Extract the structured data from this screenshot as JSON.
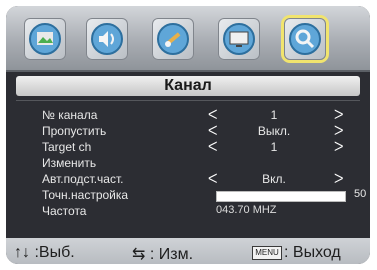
{
  "icons": [
    {
      "name": "picture-icon"
    },
    {
      "name": "sound-icon"
    },
    {
      "name": "tools-icon"
    },
    {
      "name": "tv-screen-icon"
    },
    {
      "name": "channel-search-icon"
    }
  ],
  "menu": {
    "title": "Канал",
    "rows": [
      {
        "label": "№ канала",
        "value": "1",
        "left_arrow": "ᐸ",
        "right_arrow": "ᐳ"
      },
      {
        "label": "Пропустить",
        "value": "Выкл.",
        "left_arrow": "ᐸ",
        "right_arrow": "ᐳ"
      },
      {
        "label": "Target ch",
        "value": "1",
        "left_arrow": "ᐸ",
        "right_arrow": "ᐳ"
      },
      {
        "label": "Изменить"
      },
      {
        "label": "Авт.подст.част.",
        "value": "Вкл.",
        "left_arrow": "ᐸ",
        "right_arrow": "ᐳ"
      },
      {
        "label": "Точн.настройка",
        "bar_value": "50",
        "bar_fill_fraction": 1.0
      },
      {
        "label": "Частота",
        "freq": "043.70 MHZ"
      }
    ]
  },
  "footer": {
    "select_text": "↑↓ :Выб.",
    "change_text": "⇆ : Изм.",
    "menu_key": "MENU",
    "exit_text": ": Выход"
  },
  "colors": {
    "accent_selected": "#f1e46e"
  }
}
